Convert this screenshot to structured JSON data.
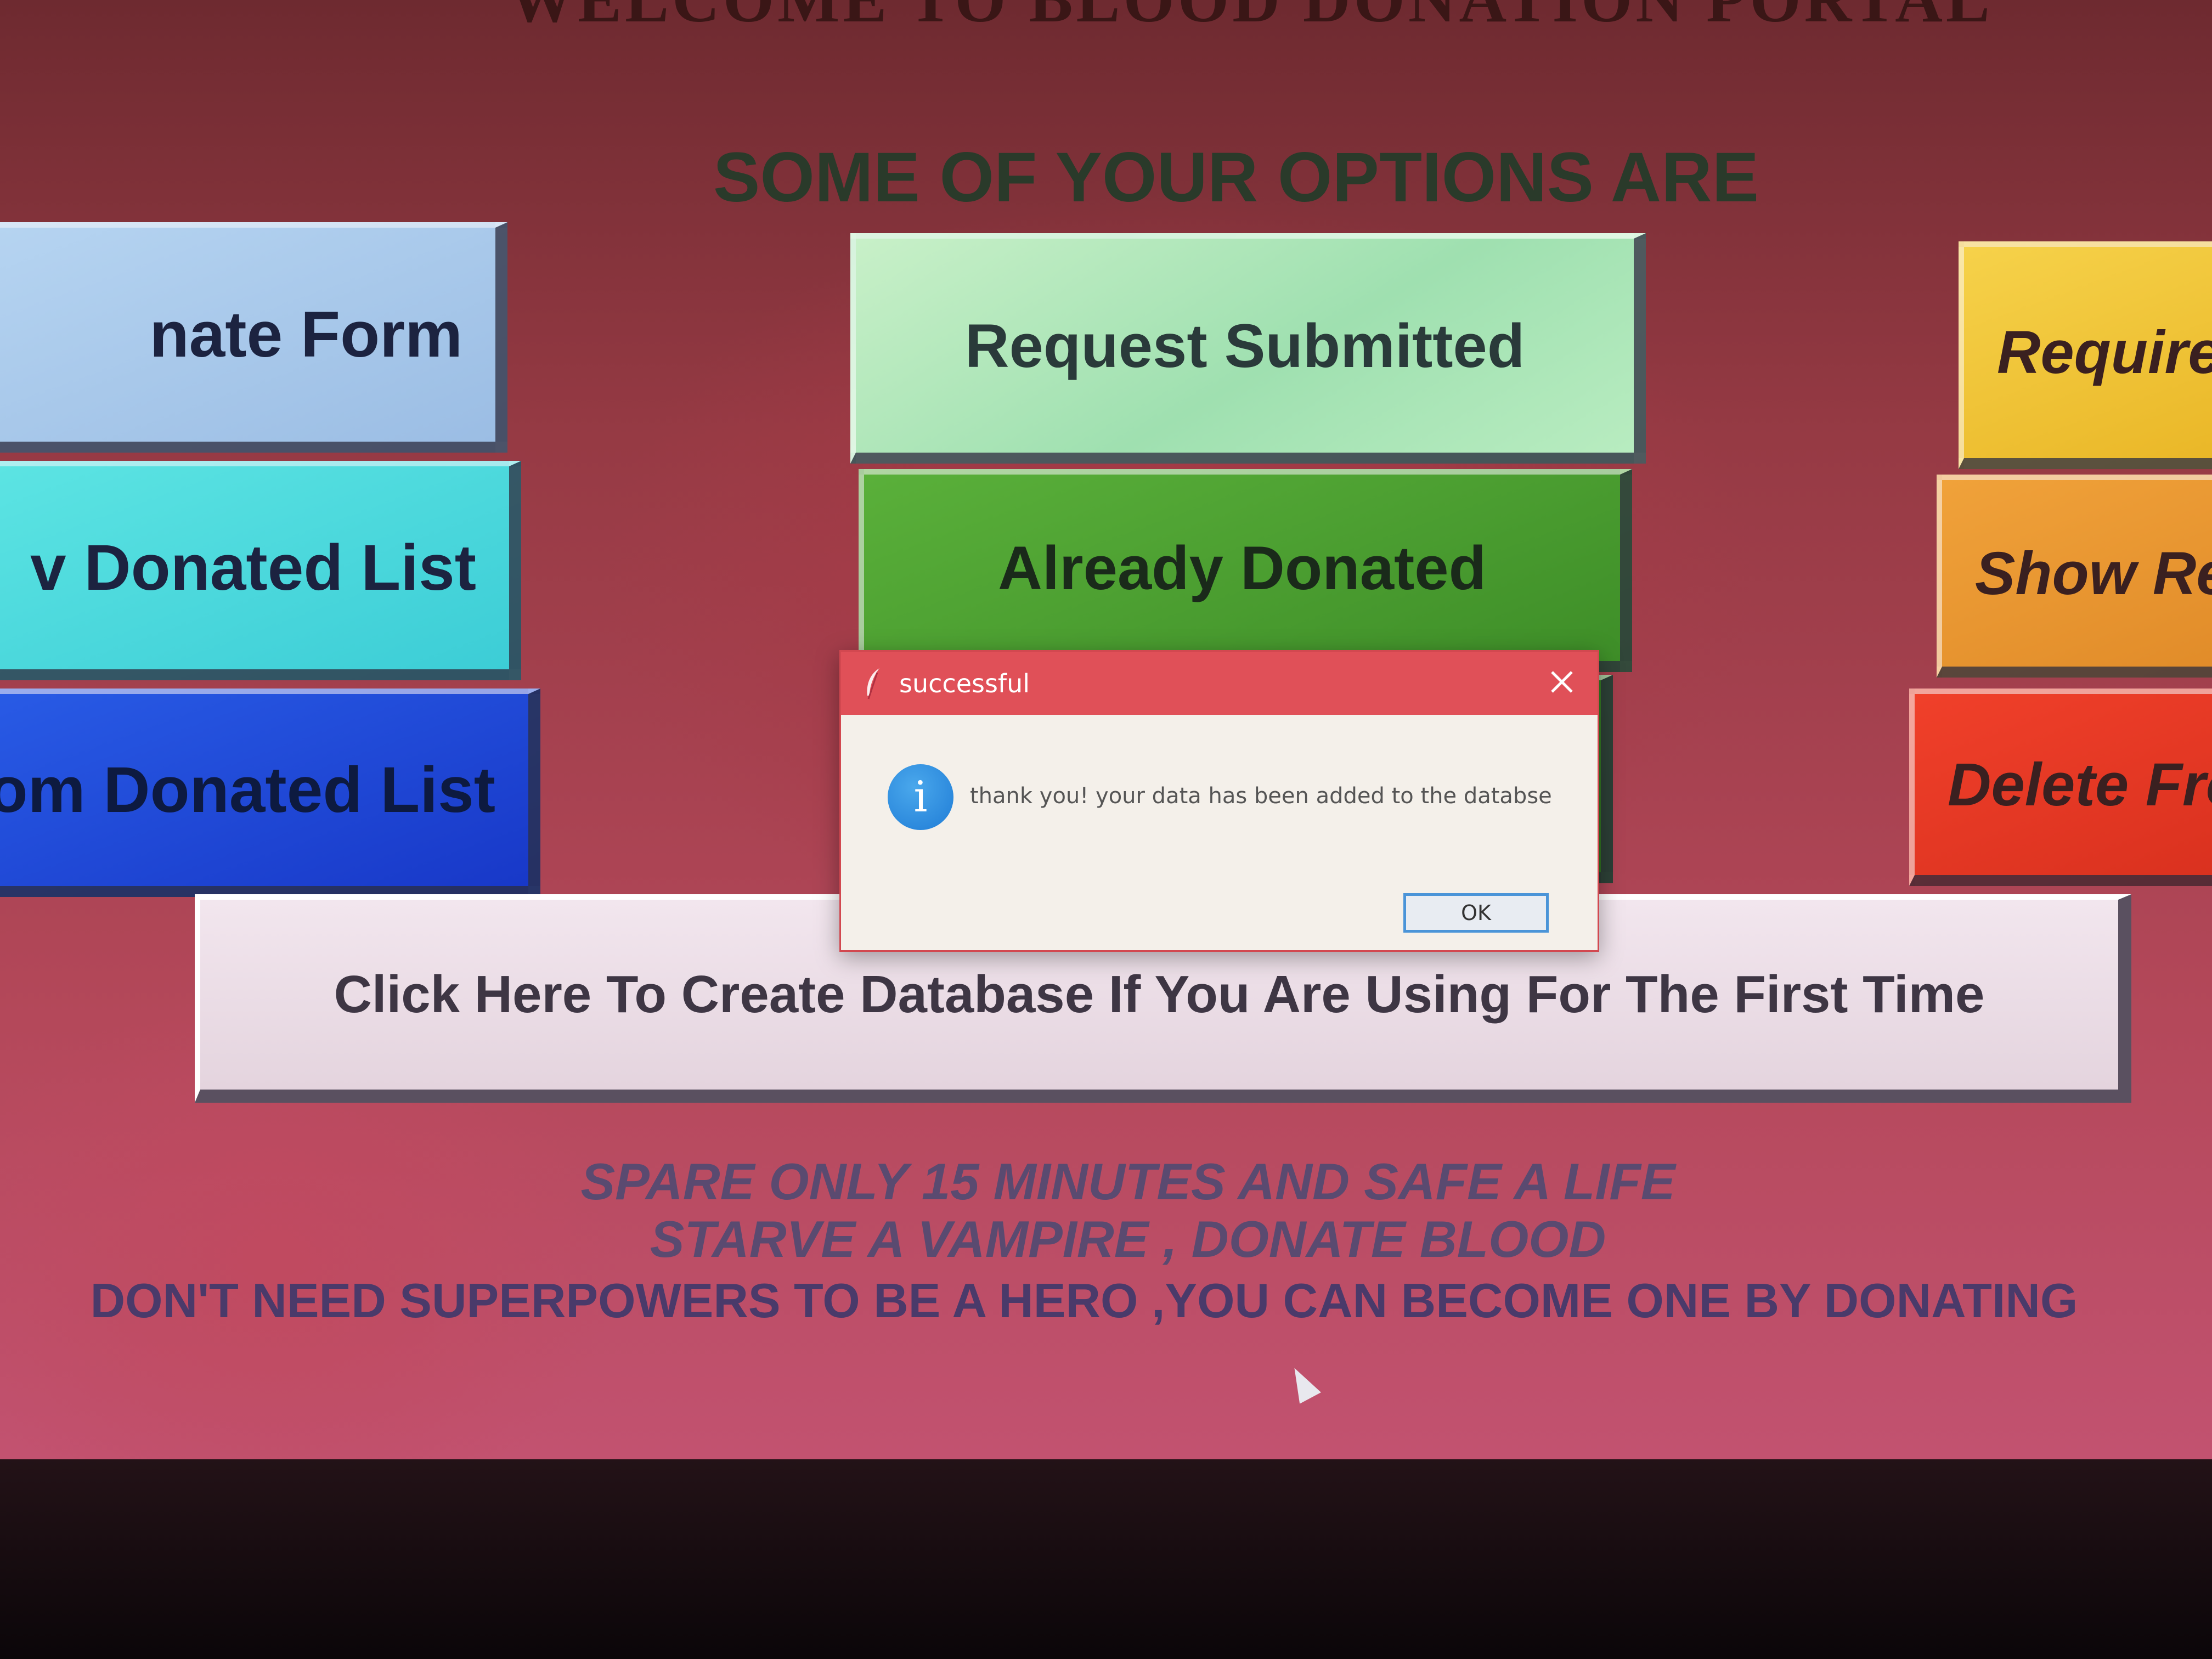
{
  "portal": {
    "title": "WELCOME TO BLOOD DONATION PORTAL",
    "options_heading": "SOME OF YOUR OPTIONS ARE"
  },
  "buttons": {
    "left": [
      {
        "label": "nate Form",
        "color": "#a9c9ec"
      },
      {
        "label": "v Donated List",
        "color": "#4edadd"
      },
      {
        "label": "From Donated List",
        "color": "#2048d8"
      }
    ],
    "middle": [
      {
        "label": "Request Submitted",
        "color": "#aee8bc"
      },
      {
        "label": "Already Donated",
        "color": "#4e9e32"
      },
      {
        "label": "",
        "color": "#3e8e28"
      }
    ],
    "right": [
      {
        "label": "Required",
        "color": "#f2c63a"
      },
      {
        "label": "Show Re",
        "color": "#e8962f"
      },
      {
        "label": "Delete Fro",
        "color": "#e63a24"
      }
    ]
  },
  "create_database": {
    "label": "Click Here To Create Database If You Are Using For The First Time"
  },
  "slogans": [
    "SPARE ONLY 15 MINUTES AND SAFE A LIFE",
    "STARVE A VAMPIRE , DONATE BLOOD",
    "DON'T NEED SUPERPOWERS TO BE A HERO ,YOU CAN BECOME ONE BY DONATING"
  ],
  "dialog": {
    "title": "successful",
    "message": "thank you! your data has been added to the databse",
    "ok_label": "OK",
    "titlebar_color": "#e05058",
    "icon": "info-icon"
  }
}
